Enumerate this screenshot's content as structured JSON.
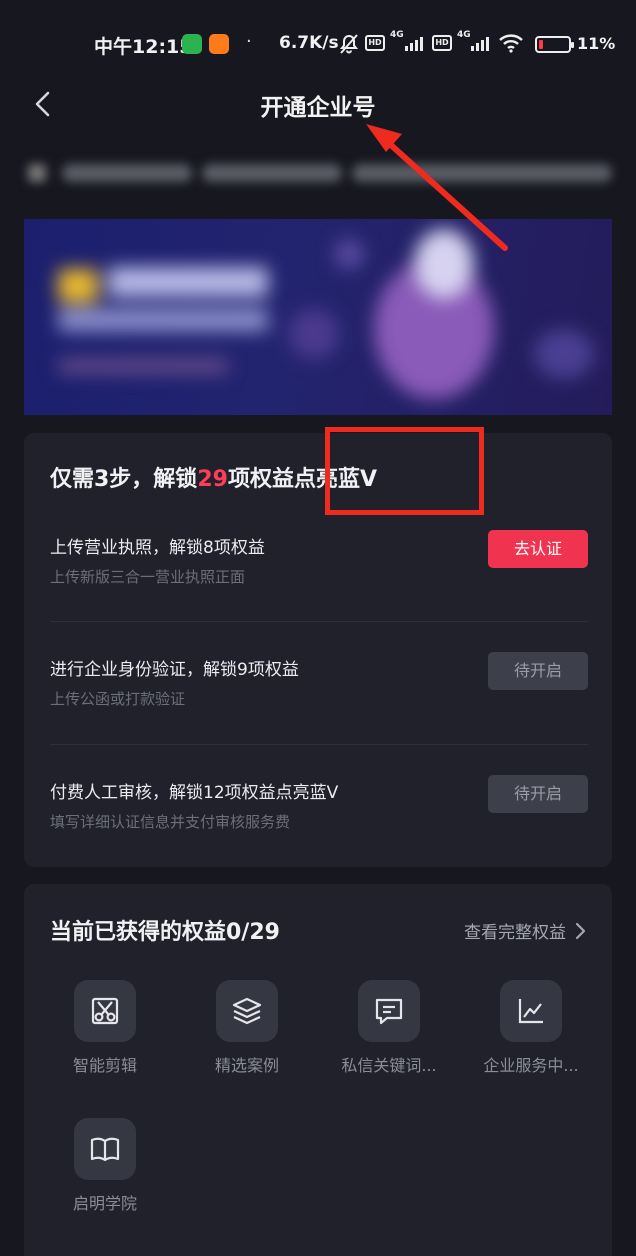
{
  "status_bar": {
    "time": "中午12:15",
    "separator": "·",
    "net_speed": "6.7K/s",
    "sim1": "4G",
    "sim2": "4G",
    "hd": "HD",
    "battery": "11%",
    "icons": [
      "wechat-icon",
      "mi-icon",
      "bell-off-icon",
      "signal-icon",
      "wifi-icon",
      "battery-icon"
    ]
  },
  "nav": {
    "title": "开通企业号"
  },
  "steps": {
    "title_prefix": "仅需3步，解锁",
    "title_count": "29",
    "title_suffix": "项权益点亮蓝V",
    "items": [
      {
        "title": "上传营业执照，解锁8项权益",
        "subtitle": "上传新版三合一营业执照正面",
        "button": "去认证",
        "state": "active"
      },
      {
        "title": "进行企业身份验证，解锁9项权益",
        "subtitle": "上传公函或打款验证",
        "button": "待开启",
        "state": "pending"
      },
      {
        "title": "付费人工审核，解锁12项权益点亮蓝V",
        "subtitle": "填写详细认证信息并支付审核服务费",
        "button": "待开启",
        "state": "pending"
      }
    ]
  },
  "benefits": {
    "title": "当前已获得的权益0/29",
    "view_all": "查看完整权益",
    "items": [
      {
        "label": "智能剪辑",
        "icon": "scissors-icon"
      },
      {
        "label": "精选案例",
        "icon": "layers-icon"
      },
      {
        "label": "私信关键词...",
        "icon": "message-icon"
      },
      {
        "label": "企业服务中...",
        "icon": "chart-icon"
      },
      {
        "label": "启明学院",
        "icon": "book-icon"
      }
    ]
  },
  "colors": {
    "background": "#16171f",
    "card": "#20212b",
    "accent": "#f0344f",
    "annotation": "#ef2a1f"
  }
}
